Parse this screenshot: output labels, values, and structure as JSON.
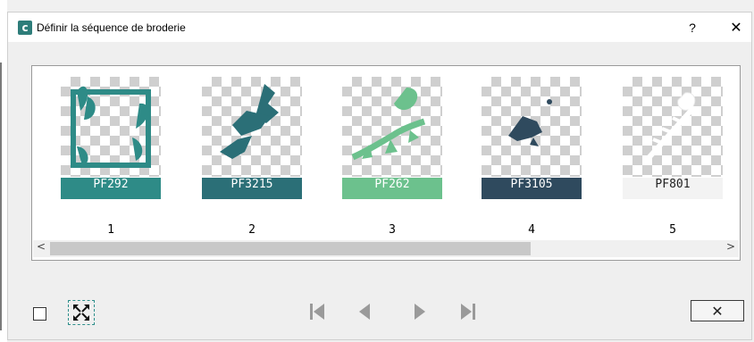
{
  "window": {
    "title": "Définir la séquence de broderie",
    "help_label": "?",
    "close_label": "✕"
  },
  "gallery": {
    "items": [
      {
        "code": "PF292",
        "number": "1",
        "color": "#2e8b87",
        "icon": "leaf-frame-design"
      },
      {
        "code": "PF3215",
        "number": "2",
        "color": "#2b6f77",
        "icon": "abstract-shapes-design"
      },
      {
        "code": "PF262",
        "number": "3",
        "color": "#6cc18d",
        "icon": "branch-design"
      },
      {
        "code": "PF3105",
        "number": "4",
        "color": "#2f4a5e",
        "icon": "bird-design"
      },
      {
        "code": "PF801",
        "number": "5",
        "color": "#f3f3f3",
        "icon": "white-floral-design"
      }
    ],
    "scroll_left": "<",
    "scroll_right": ">"
  },
  "footer": {
    "cancel_label": "✕"
  }
}
